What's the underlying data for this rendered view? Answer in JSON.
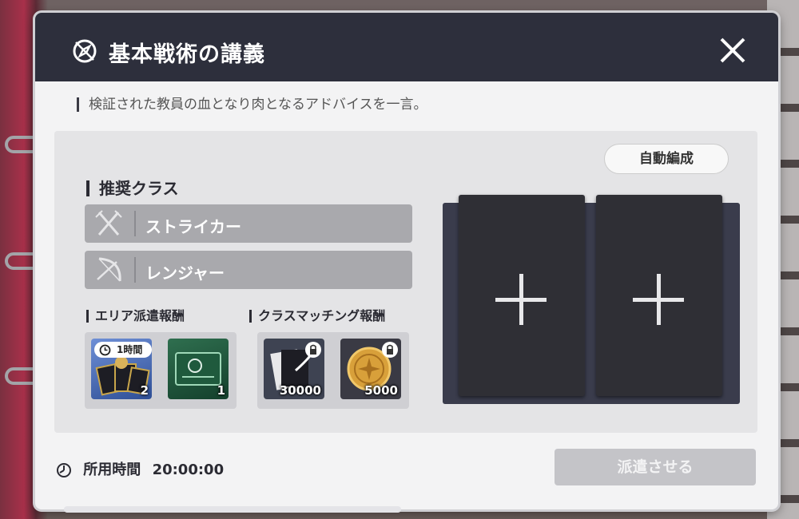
{
  "header": {
    "title": "基本戦術の講義",
    "icon": "compass-icon",
    "close_icon": "close-icon"
  },
  "subtitle": "検証された教員の血となり肉となるアドバイスを一言。",
  "auto_form_label": "自動編成",
  "recommended": {
    "heading": "推奨クラス",
    "classes": [
      {
        "label": "ストライカー",
        "icon": "crossed-swords-icon"
      },
      {
        "label": "レンジャー",
        "icon": "bow-icon"
      }
    ]
  },
  "area_reward": {
    "heading": "エリア派遣報酬",
    "items": [
      {
        "name": "cards-item",
        "count": "2",
        "badge": "1時間"
      },
      {
        "name": "green-card-item",
        "count": "1"
      }
    ]
  },
  "class_reward": {
    "heading": "クラスマッチング報酬",
    "items": [
      {
        "name": "documents-item",
        "count": "30000",
        "locked": true
      },
      {
        "name": "gold-coin-item",
        "count": "5000",
        "locked": true
      }
    ]
  },
  "footer": {
    "time_label": "所用時間",
    "time_value": "20:00:00",
    "dispatch_label": "派遣させる"
  },
  "colors": {
    "header_bg": "#2d2f3c",
    "panel_bg": "#f3f3f4",
    "slot_bg": "#2f2f35",
    "class_row_bg": "#a9a9ad"
  }
}
